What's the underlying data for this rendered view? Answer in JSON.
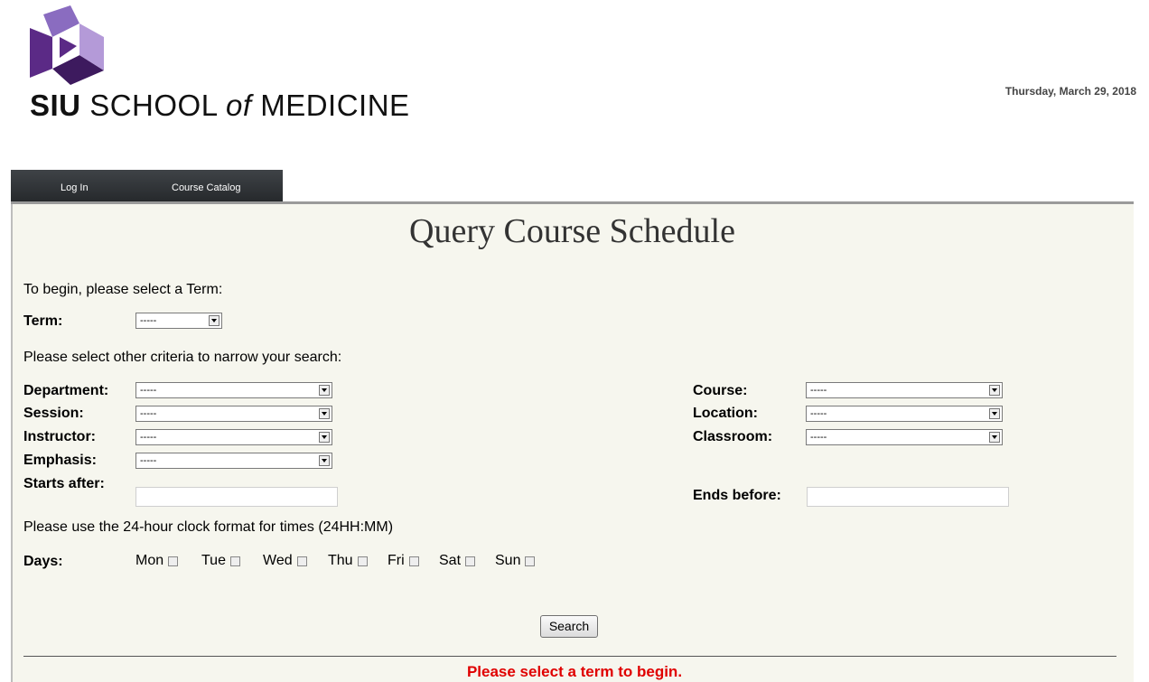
{
  "header": {
    "logo_brand": "SIU",
    "logo_school": "SCHOOL",
    "logo_of": "of",
    "logo_medicine": "MEDICINE",
    "date": "Thursday, March 29, 2018"
  },
  "nav": {
    "items": [
      {
        "label": "Log In"
      },
      {
        "label": "Course Catalog"
      }
    ]
  },
  "page": {
    "title": "Query Course Schedule",
    "intro": "To begin, please select a Term:",
    "criteria_intro": "Please select other criteria to narrow your search:",
    "time_hint": "Please use the 24-hour clock format for times (24HH:MM)",
    "error_message": "Please select a term to begin."
  },
  "form": {
    "term": {
      "label": "Term:",
      "value": "-----"
    },
    "department": {
      "label": "Department:",
      "value": "-----"
    },
    "session": {
      "label": "Session:",
      "value": "-----"
    },
    "instructor": {
      "label": "Instructor:",
      "value": "-----"
    },
    "emphasis": {
      "label": "Emphasis:",
      "value": "-----"
    },
    "starts_after": {
      "label": "Starts after:",
      "value": ""
    },
    "course": {
      "label": "Course:",
      "value": "-----"
    },
    "location": {
      "label": "Location:",
      "value": "-----"
    },
    "classroom": {
      "label": "Classroom:",
      "value": "-----"
    },
    "ends_before": {
      "label": "Ends before:",
      "value": ""
    },
    "days_label": "Days:",
    "days": [
      "Mon",
      "Tue",
      "Wed",
      "Thu",
      "Fri",
      "Sat",
      "Sun"
    ],
    "search_label": "Search"
  },
  "colors": {
    "logo_purple": "#5b2a86",
    "nav_bg": "#2f3235",
    "panel_bg": "#f6f6ee",
    "error": "#e00000"
  }
}
